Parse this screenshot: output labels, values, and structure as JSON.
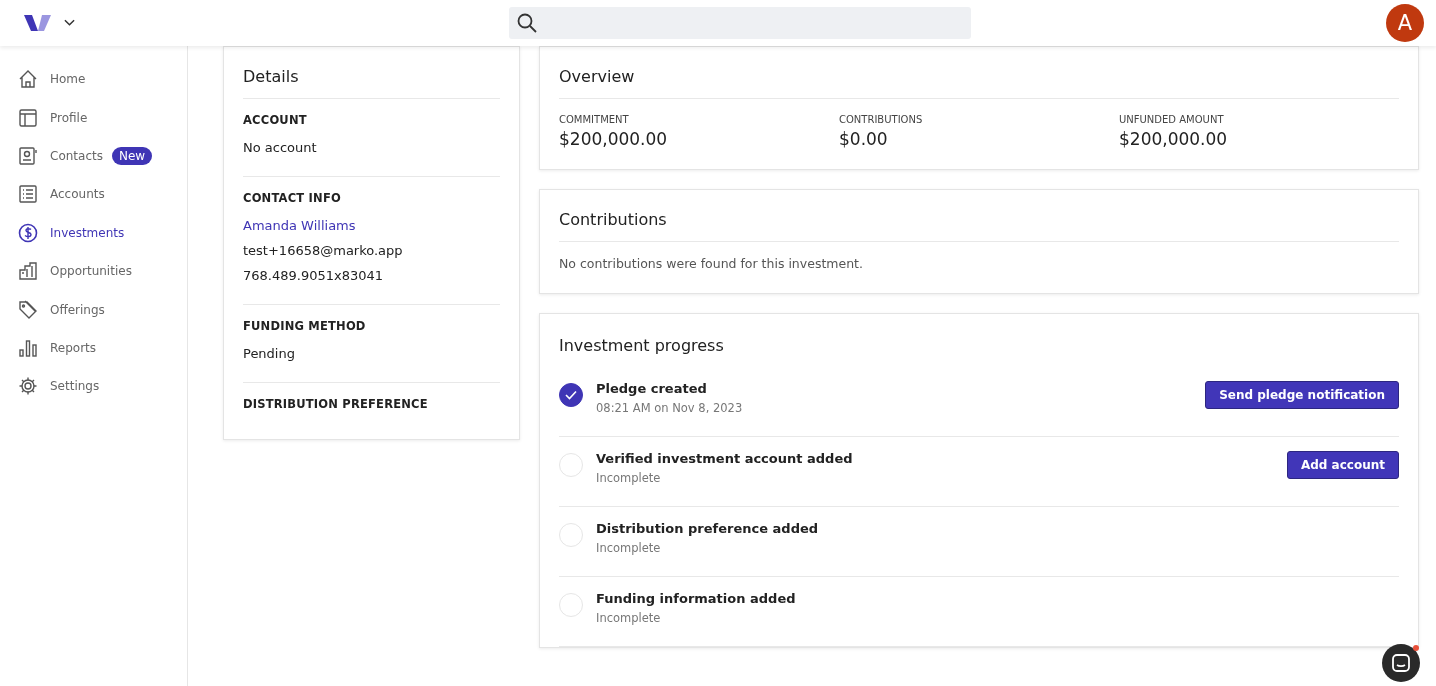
{
  "header": {
    "avatar_letter": "A"
  },
  "sidebar": {
    "items": [
      {
        "label": "Home",
        "selected": false
      },
      {
        "label": "Profile",
        "selected": false
      },
      {
        "label": "Contacts",
        "selected": false,
        "badge": "New"
      },
      {
        "label": "Accounts",
        "selected": false
      },
      {
        "label": "Investments",
        "selected": true
      },
      {
        "label": "Opportunities",
        "selected": false
      },
      {
        "label": "Offerings",
        "selected": false
      },
      {
        "label": "Reports",
        "selected": false
      },
      {
        "label": "Settings",
        "selected": false
      }
    ]
  },
  "details": {
    "title": "Details",
    "sections": [
      {
        "heading": "ACCOUNT",
        "lines": [
          {
            "text": "No account",
            "kind": "text"
          }
        ]
      },
      {
        "heading": "CONTACT INFO",
        "lines": [
          {
            "text": "Amanda Williams",
            "kind": "link"
          },
          {
            "text": "test+16658@marko.app",
            "kind": "text"
          },
          {
            "text": "768.489.9051x83041",
            "kind": "text"
          }
        ]
      },
      {
        "heading": "FUNDING METHOD",
        "lines": [
          {
            "text": "Pending",
            "kind": "text"
          }
        ]
      },
      {
        "heading": "DISTRIBUTION PREFERENCE"
      }
    ]
  },
  "overview": {
    "title": "Overview",
    "metrics": [
      {
        "label": "COMMITMENT",
        "value": "$200,000.00"
      },
      {
        "label": "CONTRIBUTIONS",
        "value": "$0.00"
      },
      {
        "label": "UNFUNDED AMOUNT",
        "value": "$200,000.00"
      }
    ]
  },
  "contributions": {
    "title": "Contributions",
    "message": "No contributions were found for this investment."
  },
  "progress": {
    "title": "Investment progress",
    "steps": [
      {
        "title": "Pledge created",
        "subtitle": "08:21 AM on Nov 8, 2023",
        "done": true,
        "button": "Send pledge notification"
      },
      {
        "title": "Verified investment account added",
        "subtitle": "Incomplete",
        "done": false,
        "button": "Add account"
      },
      {
        "title": "Distribution preference added",
        "subtitle": "Incomplete",
        "done": false
      },
      {
        "title": "Funding information added",
        "subtitle": "Incomplete",
        "done": false
      }
    ]
  }
}
